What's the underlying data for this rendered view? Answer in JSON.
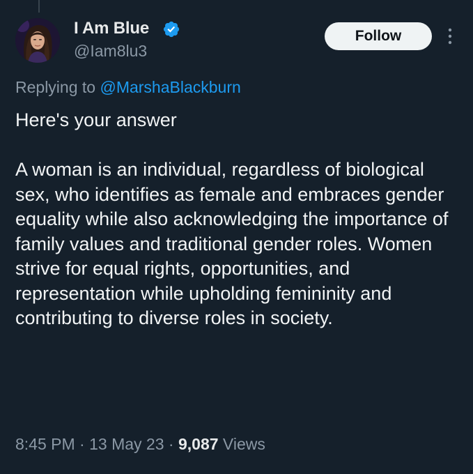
{
  "author": {
    "display_name": "I Am Blue",
    "handle": "@Iam8lu3",
    "verified_color": "#1d9bf0"
  },
  "follow_button": {
    "label": "Follow"
  },
  "more_menu": {
    "icon": "more-vertical-icon"
  },
  "reply_context": {
    "prefix": "Replying to",
    "mention": "@MarshaBlackburn"
  },
  "tweet": {
    "text": "Here's your answer\n\nA woman is an individual, regardless of biological sex, who identifies as female and embraces gender equality while also acknowledging the importance of family values and traditional gender roles. Women strive for equal rights, opportunities, and representation while upholding femininity and contributing to diverse roles in society."
  },
  "meta": {
    "time": "8:45 PM",
    "date": "13 May 23",
    "separator": "·",
    "views_count": "9,087",
    "views_label": "Views"
  },
  "colors": {
    "background": "#15202b",
    "text": "#e7e9ea",
    "secondary": "#8b98a5",
    "accent": "#1d9bf0"
  }
}
